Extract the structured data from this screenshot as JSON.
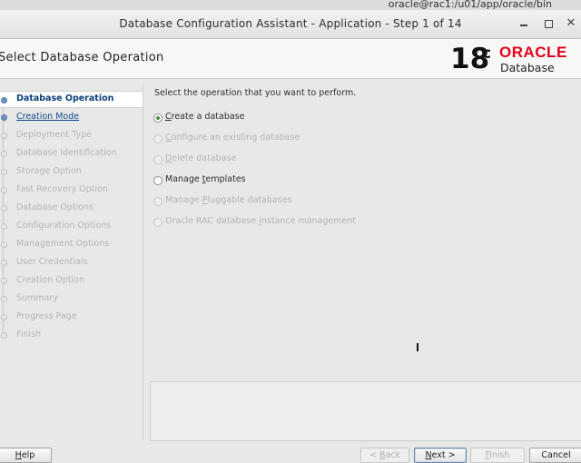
{
  "system_path": "oracle@rac1:/u01/app/oracle/bin",
  "window": {
    "title": "Database Configuration Assistant - Application - Step 1 of 14",
    "minimize_glyph": "",
    "maximize_glyph": "",
    "close_glyph": "✕"
  },
  "header": {
    "page_title": "Select Database Operation",
    "logo": {
      "version": "18",
      "version_sup": "c",
      "brand": "ORACLE",
      "product": "Database",
      "brand_color": "#e2001a"
    }
  },
  "nav": {
    "steps": [
      {
        "label": "Database Operation",
        "state": "current"
      },
      {
        "label": "Creation Mode",
        "state": "link"
      },
      {
        "label": "Deployment Type",
        "state": "disabled"
      },
      {
        "label": "Database Identification",
        "state": "disabled"
      },
      {
        "label": "Storage Option",
        "state": "disabled"
      },
      {
        "label": "Fast Recovery Option",
        "state": "disabled"
      },
      {
        "label": "Database Options",
        "state": "disabled"
      },
      {
        "label": "Configuration Options",
        "state": "disabled"
      },
      {
        "label": "Management Options",
        "state": "disabled"
      },
      {
        "label": "User Credentials",
        "state": "disabled"
      },
      {
        "label": "Creation Option",
        "state": "disabled"
      },
      {
        "label": "Summary",
        "state": "disabled"
      },
      {
        "label": "Progress Page",
        "state": "disabled"
      },
      {
        "label": "Finish",
        "state": "disabled"
      }
    ]
  },
  "main": {
    "prompt": "Select the operation that you want to perform.",
    "options": [
      {
        "pre": "",
        "mn": "C",
        "post": "reate a database",
        "checked": true,
        "enabled": true
      },
      {
        "pre": "",
        "mn": "C",
        "post": "onfigure an existing database",
        "checked": false,
        "enabled": false
      },
      {
        "pre": "",
        "mn": "D",
        "post": "elete database",
        "checked": false,
        "enabled": false
      },
      {
        "pre": "Manage ",
        "mn": "t",
        "post": "emplates",
        "checked": false,
        "enabled": true
      },
      {
        "pre": "Manage ",
        "mn": "P",
        "post": "luggable databases",
        "checked": false,
        "enabled": false
      },
      {
        "pre": "Oracle RAC database ",
        "mn": "i",
        "post": "nstance management",
        "checked": false,
        "enabled": false
      }
    ]
  },
  "buttons": {
    "help": {
      "mn": "H",
      "rest": "elp"
    },
    "back": {
      "pre": "< ",
      "mn": "B",
      "rest": "ack"
    },
    "next": {
      "mn": "N",
      "rest": "ext >"
    },
    "finish": {
      "mn": "F",
      "rest": "inish"
    },
    "cancel": "Cancel"
  }
}
